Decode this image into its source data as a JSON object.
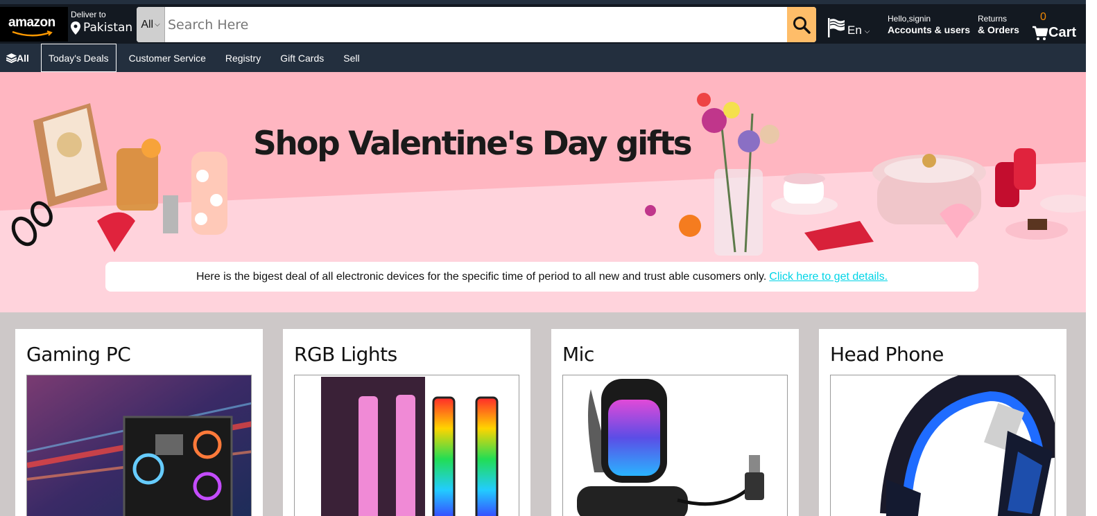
{
  "header": {
    "logo_text": "amazon",
    "deliver_label": "Deliver to",
    "deliver_location": "Pakistan",
    "search_category": "All",
    "search_placeholder": "Search Here",
    "language": "En",
    "account_greeting": "Hello,signin",
    "account_label": "Accounts & users",
    "returns_label": "Returns",
    "orders_label": "& Orders",
    "cart_count": "0",
    "cart_label": "Cart"
  },
  "subnav": {
    "all_label": "All",
    "items": [
      "Today's Deals",
      "Customer Service",
      "Registry",
      "Gift Cards",
      "Sell"
    ]
  },
  "hero": {
    "title": "Shop Valentine's Day gifts",
    "notice_text": "Here is the bigest deal of all electronic devices for the specific time of period to all new and trust able cusomers only.",
    "notice_link": "Click here to get details.",
    "colors": {
      "background": "#ffb6c1",
      "link": "#00d4e6"
    }
  },
  "cards": [
    {
      "title": "Gaming PC"
    },
    {
      "title": "RGB Lights"
    },
    {
      "title": "Mic"
    },
    {
      "title": "Head Phone"
    }
  ],
  "colors": {
    "nav_bg": "#131921",
    "subnav_bg": "#232f3e",
    "search_button": "#febd69",
    "cart_count": "#f08804",
    "cards_bg": "#cdc8c8"
  }
}
